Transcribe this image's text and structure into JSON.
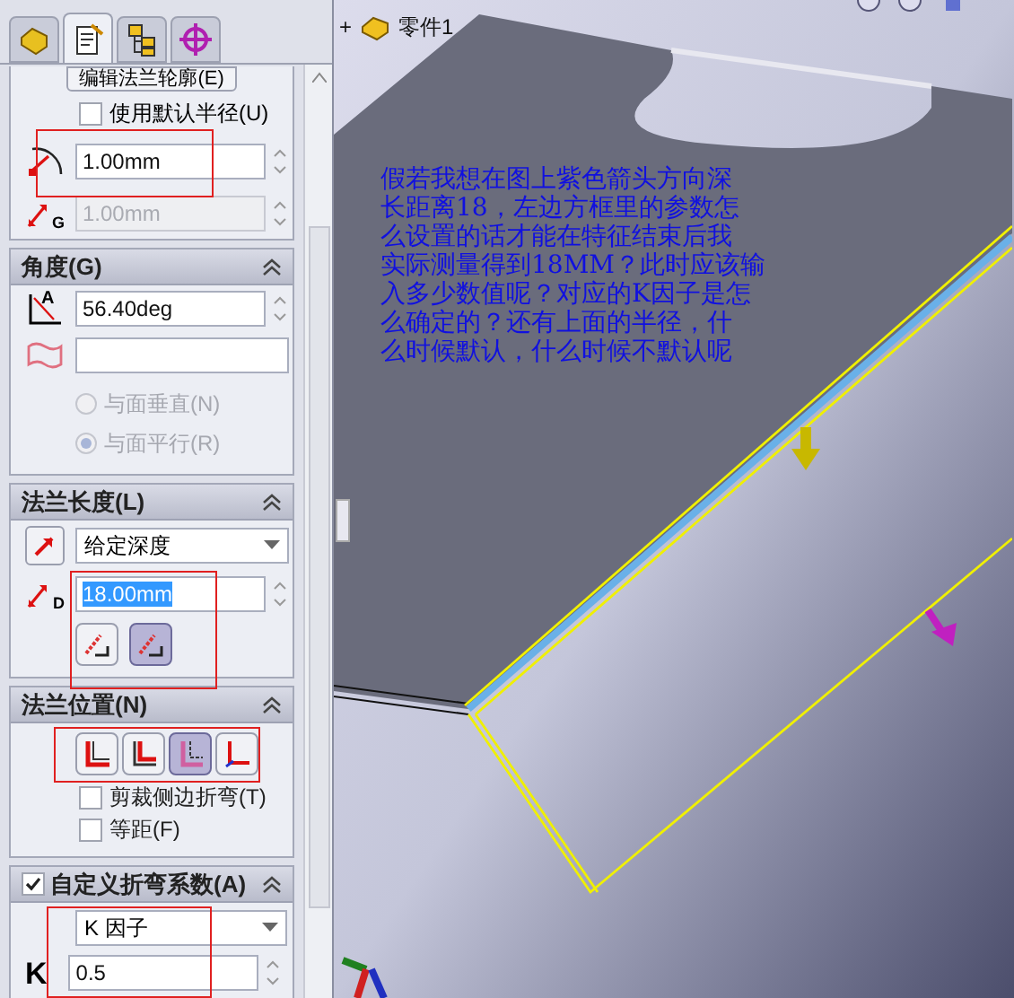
{
  "tabs": [
    {
      "kind": "feature",
      "selected": false
    },
    {
      "kind": "property",
      "selected": true
    },
    {
      "kind": "configuration",
      "selected": false
    },
    {
      "kind": "display",
      "selected": false
    }
  ],
  "edit_profile_button": "编辑法兰轮廓(E)",
  "bend_radius": {
    "use_default": {
      "label": "使用默认半径(U)",
      "checked": false
    },
    "radius": "1.00mm",
    "gap_letter": "G",
    "gap": {
      "value": "1.00mm",
      "disabled": true
    }
  },
  "angle": {
    "title": "角度(G)",
    "icon_letter": "A",
    "value": "56.40deg",
    "radios": [
      {
        "label": "与面垂直(N)",
        "selected": false,
        "disabled": true
      },
      {
        "label": "与面平行(R)",
        "selected": true,
        "disabled": true
      }
    ]
  },
  "flange_length": {
    "title": "法兰长度(L)",
    "end_condition": "给定深度",
    "icon_letter": "D",
    "value": "18.00mm",
    "value_highlighted": true,
    "measure_buttons": [
      {
        "selected": false
      },
      {
        "selected": true
      }
    ]
  },
  "flange_position": {
    "title": "法兰位置(N)",
    "buttons": [
      {
        "kind": "material_inside",
        "selected": false
      },
      {
        "kind": "material_outside",
        "selected": false
      },
      {
        "kind": "bend_outside",
        "selected": true
      },
      {
        "kind": "virtual_sharp",
        "selected": false
      }
    ],
    "options": [
      {
        "label": "剪裁侧边折弯(T)",
        "checked": false
      },
      {
        "label": "等距(F)",
        "checked": false
      }
    ]
  },
  "bend_allowance": {
    "title": "自定义折弯系数(A)",
    "checked": true,
    "type": "K 因子",
    "k_label": "K",
    "k_value": "0.5"
  },
  "tree": {
    "expander": "+",
    "label": "零件1"
  },
  "note": {
    "lines": [
      "假若我想在图上紫色箭头方向深",
      "长距离18，左边方框里的参数怎",
      "么设置的话才能在特征结束后我",
      "实际测量得到18MM？此时应该输",
      "入多少数值呢？对应的K因子是怎",
      "么确定的？还有上面的半径，什",
      "么时候默认，什么时候不默认呢"
    ]
  }
}
